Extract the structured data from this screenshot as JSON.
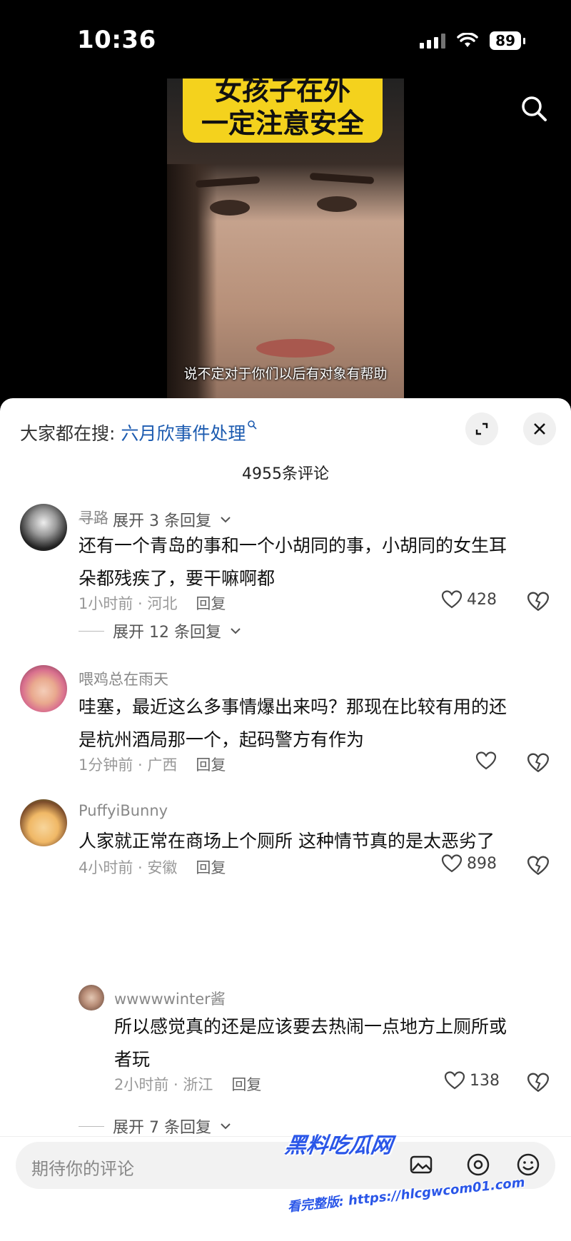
{
  "status_bar": {
    "time": "10:36",
    "battery": "89"
  },
  "video": {
    "overlay_title": "女孩子在外\n一定注意安全",
    "subtitle": "说不定对于你们以后有对象有帮助"
  },
  "trending": {
    "label": "大家都在搜: ",
    "link": "六月欣事件处理"
  },
  "comments_count": "4955条评论",
  "expand_labels": [
    "展开 3 条回复",
    "展开 12 条回复",
    "展开 7 条回复"
  ],
  "comments": [
    {
      "user": "寻路",
      "text_lines": [
        "还有一个青岛的事和一个小胡同的事，小胡同的女生耳",
        "朵都残疾了，要干嘛啊都"
      ],
      "time_loc": "1小时前 · 河北",
      "reply": "回复",
      "likes": "428"
    },
    {
      "user": "喂鸡总在雨天",
      "text_lines": [
        "哇塞，最近这么多事情爆出来吗？那现在比较有用的还",
        "是杭州酒局那一个，起码警方有作为"
      ],
      "time_loc": "1分钟前 · 广西",
      "reply": "回复",
      "likes": ""
    },
    {
      "user": "PuffyiBunny",
      "text_lines": [
        "人家就正常在商场上个厕所 这种情节真的是太恶劣了"
      ],
      "time_loc": "4小时前 · 安徽",
      "reply": "回复",
      "likes": "898"
    }
  ],
  "sub_reply": {
    "user": "wwwwwinter酱",
    "text_lines": [
      "所以感觉真的还是应该要去热闹一点地方上厕所或",
      "者玩"
    ],
    "time_loc": "2小时前 · 浙江",
    "reply": "回复",
    "likes": "138"
  },
  "input": {
    "placeholder": "期待你的评论"
  },
  "watermark": {
    "brand": "黑料吃瓜网",
    "url_text": "看完整版: https://hlcgwcom01.com"
  }
}
